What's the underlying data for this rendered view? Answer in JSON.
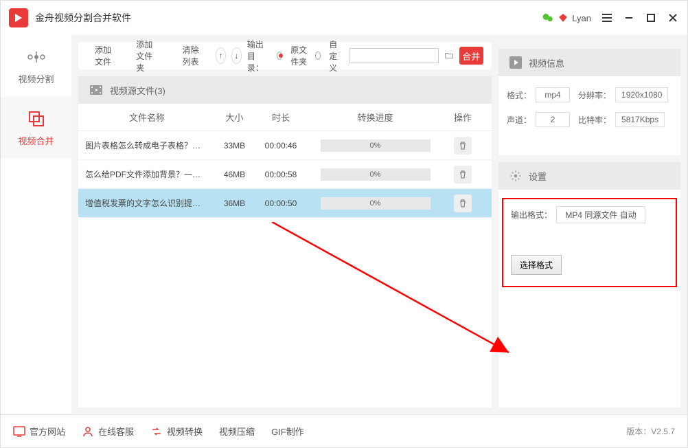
{
  "app": {
    "title": "金舟视频分割合并软件"
  },
  "user": {
    "name": "Lyan"
  },
  "sidebar": {
    "split": "视频分割",
    "merge": "视频合并"
  },
  "toolbar": {
    "add_file": "添加文件",
    "add_folder": "添加文件夹",
    "clear": "清除列表",
    "output_label": "输出目录：",
    "orig_folder": "原文件夹",
    "custom": "自定义",
    "merge": "合并"
  },
  "table": {
    "header_title": "视频源文件(3)",
    "cols": {
      "name": "文件名称",
      "size": "大小",
      "dur": "时长",
      "prog": "转换进度",
      "op": "操作"
    },
    "rows": [
      {
        "name": "图片表格怎么转成电子表格？…",
        "size": "33MB",
        "dur": "00:00:46",
        "prog": "0%",
        "selected": false
      },
      {
        "name": "怎么给PDF文件添加背景？一…",
        "size": "46MB",
        "dur": "00:00:58",
        "prog": "0%",
        "selected": false
      },
      {
        "name": "增值税发票的文字怎么识别提…",
        "size": "36MB",
        "dur": "00:00:50",
        "prog": "0%",
        "selected": true
      }
    ]
  },
  "info": {
    "title": "视频信息",
    "format_label": "格式：",
    "format": "mp4",
    "res_label": "分辨率：",
    "res": "1920x1080",
    "channel_label": "声道：",
    "channel": "2",
    "bitrate_label": "比特率：",
    "bitrate": "5817Kbps"
  },
  "settings": {
    "title": "设置",
    "out_fmt_label": "输出格式：",
    "out_fmt": "MP4 同源文件 自动",
    "choose": "选择格式"
  },
  "footer": {
    "site": "官方网站",
    "chat": "在线客服",
    "convert": "视频转换",
    "compress": "视频压缩",
    "gif": "GIF制作",
    "version_label": "版本：",
    "version": "V2.5.7"
  }
}
